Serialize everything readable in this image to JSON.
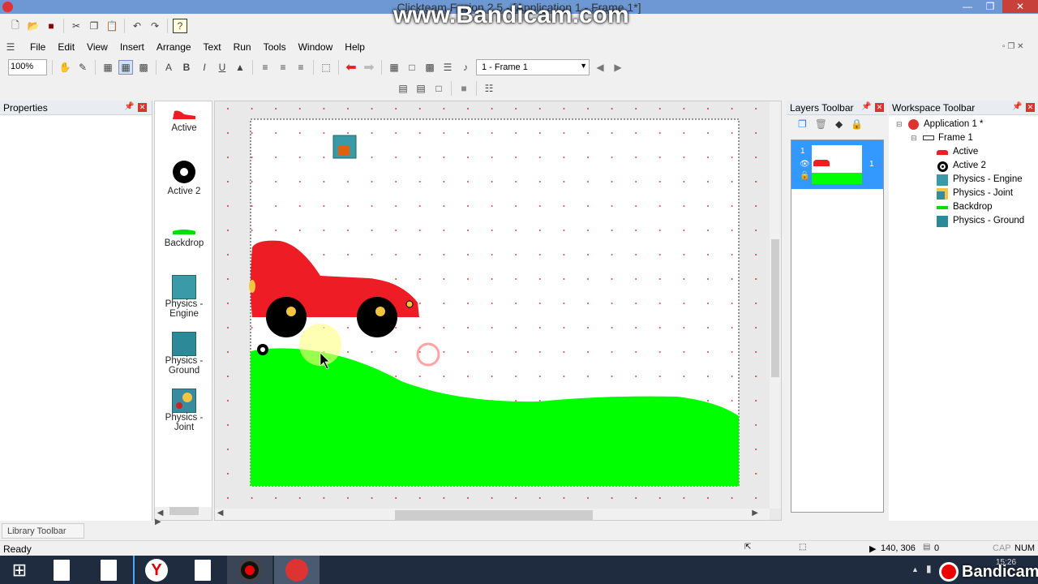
{
  "window": {
    "title": "Clickteam Fusion 2.5 - [Application 1 - Frame 1*]",
    "watermark": "www.Bandicam.com"
  },
  "menu": [
    "File",
    "Edit",
    "View",
    "Insert",
    "Arrange",
    "Text",
    "Run",
    "Tools",
    "Window",
    "Help"
  ],
  "toolbar": {
    "zoom": "100%",
    "frame_select": "1 - Frame 1"
  },
  "properties": {
    "title": "Properties"
  },
  "library": {
    "items": [
      {
        "label": "Active"
      },
      {
        "label": "Active 2"
      },
      {
        "label": "Backdrop"
      },
      {
        "label": "Physics - Engine"
      },
      {
        "label": "Physics - Ground"
      },
      {
        "label": "Physics - Joint"
      }
    ],
    "tab": "Library Toolbar"
  },
  "layers": {
    "title": "Layers Toolbar",
    "layer_number": "1",
    "layer_count": "1"
  },
  "workspace": {
    "title": "Workspace Toolbar",
    "application": "Application 1 *",
    "frame": "Frame 1",
    "objects": [
      "Active",
      "Active 2",
      "Physics - Engine",
      "Physics - Joint",
      "Backdrop",
      "Physics - Ground"
    ]
  },
  "status": {
    "text": "Ready",
    "coords": "140, 306",
    "selection_count": "0",
    "cap": "CAP",
    "num": "NUM"
  },
  "taskbar": {
    "clock": "15:26",
    "bandicam": "Bandicam"
  },
  "colors": {
    "titlebar": "#6d98d3",
    "car": "#ee1c24",
    "ground": "#00ff00",
    "taskbar": "#1f2c40",
    "layer_selected": "#3399ff"
  }
}
